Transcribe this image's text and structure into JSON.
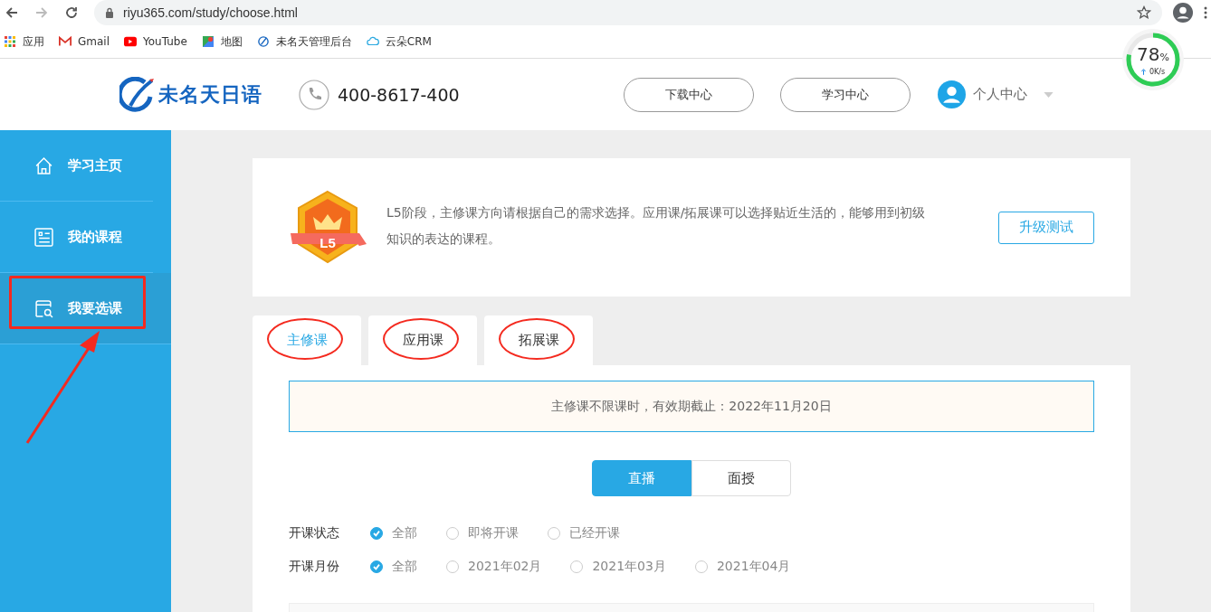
{
  "browser": {
    "url": "riyu365.com/study/choose.html",
    "bookmarks": [
      {
        "label": "应用"
      },
      {
        "label": "Gmail"
      },
      {
        "label": "YouTube"
      },
      {
        "label": "地图"
      },
      {
        "label": "未名天管理后台"
      },
      {
        "label": "云朵CRM"
      }
    ]
  },
  "speed_widget": {
    "percent": "78",
    "unit": "%",
    "rate": "0K/s",
    "level": 0.78
  },
  "header": {
    "logo": "未名天日语",
    "phone": "400-8617-400",
    "buttons": [
      "下载中心",
      "学习中心"
    ],
    "user": "个人中心"
  },
  "sidebar": {
    "items": [
      {
        "label": "学习主页",
        "selected": false,
        "highlighted": false
      },
      {
        "label": "我的课程",
        "selected": false,
        "highlighted": false
      },
      {
        "label": "我要选课",
        "selected": true,
        "highlighted": true
      }
    ]
  },
  "level_card": {
    "badge": "L5",
    "text": "L5阶段，主修课方向请根据自己的需求选择。应用课/拓展课可以选择贴近生活的，能够用到初级知识的表达的课程。",
    "button": "升级测试"
  },
  "tabs": [
    {
      "label": "主修课",
      "selected": true,
      "circled": true
    },
    {
      "label": "应用课",
      "selected": false,
      "circled": true
    },
    {
      "label": "拓展课",
      "selected": false,
      "circled": true
    }
  ],
  "notice": "主修课不限课时，有效期截止：2022年11月20日",
  "modes": [
    {
      "label": "直播",
      "selected": true
    },
    {
      "label": "面授",
      "selected": false
    }
  ],
  "filters": [
    {
      "label": "开课状态",
      "options": [
        {
          "label": "全部",
          "selected": true
        },
        {
          "label": "即将开课",
          "selected": false
        },
        {
          "label": "已经开课",
          "selected": false
        }
      ]
    },
    {
      "label": "开课月份",
      "options": [
        {
          "label": "全部",
          "selected": true
        },
        {
          "label": "2021年02月",
          "selected": false
        },
        {
          "label": "2021年03月",
          "selected": false
        },
        {
          "label": "2021年04月",
          "selected": false
        }
      ]
    }
  ]
}
